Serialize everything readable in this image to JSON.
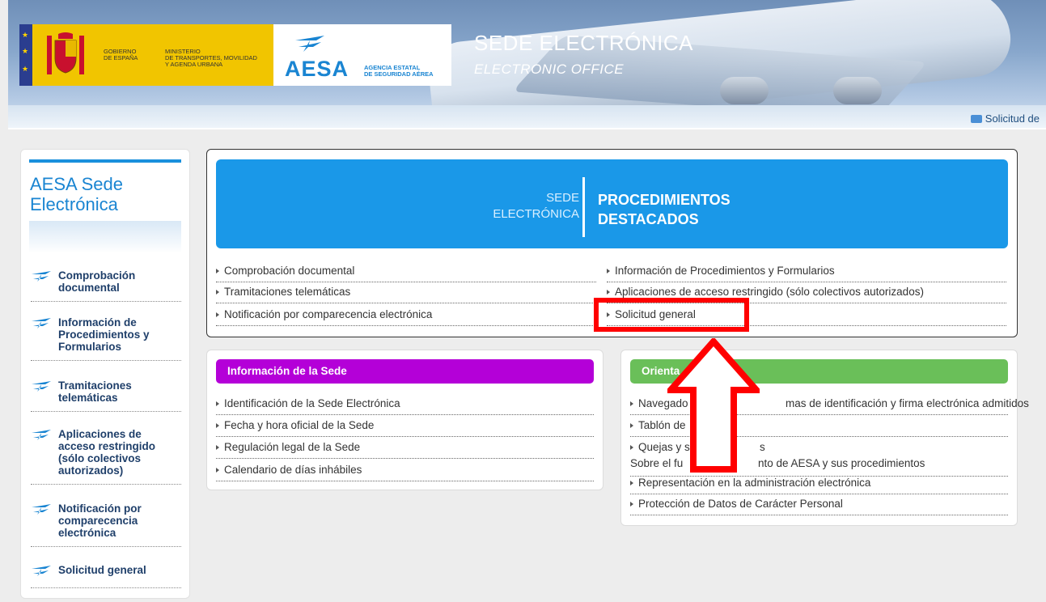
{
  "header": {
    "government": [
      "GOBIERNO",
      "DE ESPAÑA"
    ],
    "ministry": [
      "MINISTERIO",
      "DE TRANSPORTES, MOVILIDAD",
      "Y AGENDA URBANA"
    ],
    "aesa_name": "AESA",
    "aesa_agency": [
      "AGENCIA ESTATAL",
      "DE SEGURIDAD AÉREA"
    ],
    "title": "SEDE ELECTRÓNICA",
    "subtitle": "ELECTRONIC OFFICE",
    "contact_link": "Solicitud de"
  },
  "sidebar": {
    "title": [
      "AESA Sede",
      "Electrónica"
    ],
    "items": [
      {
        "label": [
          "Comprobación",
          "documental"
        ]
      },
      {
        "label": [
          "Información de",
          "Procedimientos y",
          "Formularios"
        ]
      },
      {
        "label": [
          "Tramitaciones",
          "telemáticas"
        ]
      },
      {
        "label": [
          "Aplicaciones de",
          "acceso restringido",
          "(sólo colectivos",
          "autorizados)"
        ]
      },
      {
        "label": [
          "Notificación por",
          "comparecencia",
          "electrónica"
        ]
      },
      {
        "label": [
          "Solicitud general"
        ]
      }
    ]
  },
  "featured": {
    "banner_left": [
      "SEDE",
      "ELECTRÓNICA"
    ],
    "banner_right": [
      "PROCEDIMIENTOS",
      "DESTACADOS"
    ],
    "links_left": [
      "Comprobación documental",
      "Tramitaciones telemáticas",
      "Notificación por comparecencia electrónica"
    ],
    "links_right": [
      "Información de Procedimientos y Formularios",
      "Aplicaciones de acceso restringido (sólo colectivos autorizados)",
      "Solicitud general"
    ]
  },
  "info_panel": {
    "title": "Información de la Sede",
    "color": "#b400d8",
    "links": [
      "Identificación de la Sede Electrónica",
      "Fecha y hora oficial de la Sede",
      "Regulación legal de la Sede",
      "Calendario de días inhábiles"
    ]
  },
  "orient_panel": {
    "title": "Orienta",
    "color": "#6abf59",
    "links": [
      "Navegado",
      "mas de identificación y firma electrónica admitidos",
      "Tablón de",
      "Quejas y s",
      "s",
      "Sobre el fu",
      "nto de AESA y sus procedimientos",
      "Representación en la administración electrónica",
      "Protección de Datos de Carácter Personal"
    ]
  },
  "annotation": {
    "color": "#ff0000"
  }
}
